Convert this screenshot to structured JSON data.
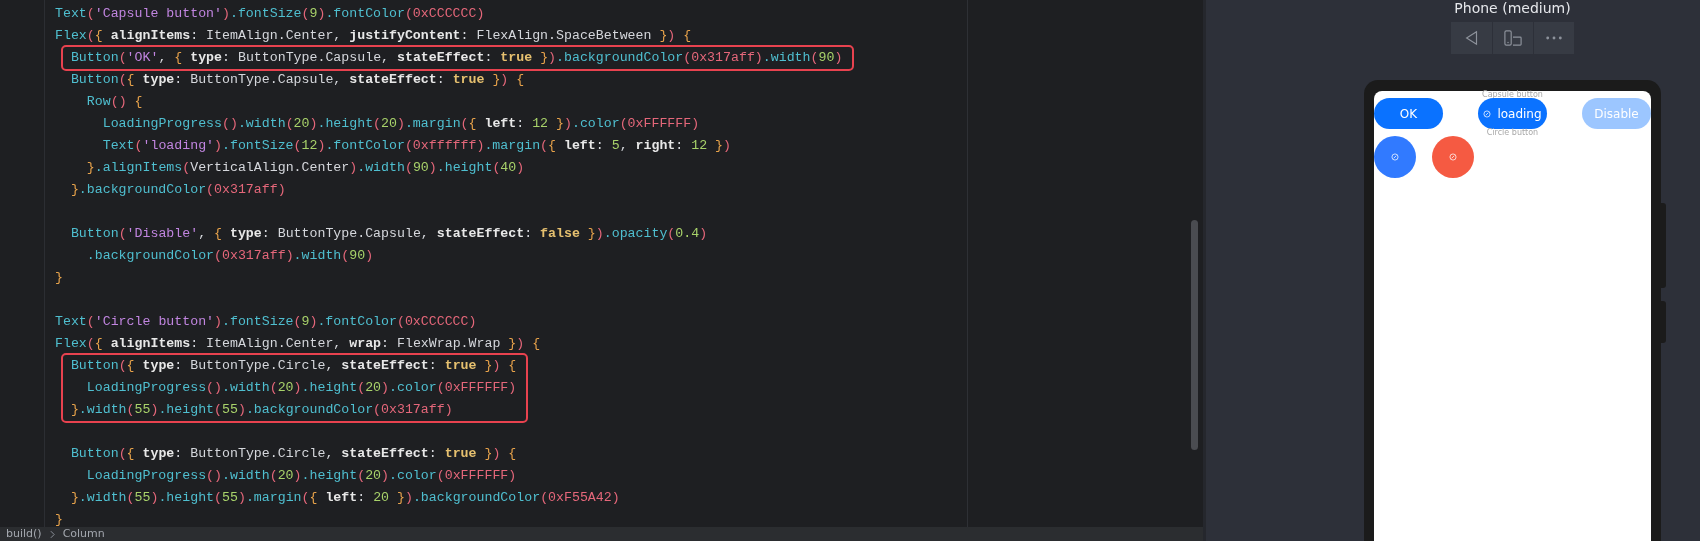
{
  "editor": {
    "code_blocks": [
      {
        "highlighted": false,
        "lines": [
          {
            "kind": "code",
            "text": "Text('Capsule button').fontSize(9).fontColor(0xCCCCCC)"
          },
          {
            "kind": "code",
            "text": "Flex({ alignItems: ItemAlign.Center, justifyContent: FlexAlign.SpaceBetween }) {"
          }
        ]
      },
      {
        "highlighted": true,
        "lines": [
          {
            "kind": "code",
            "text": "  Button('OK', { type: ButtonType.Capsule, stateEffect: true }).backgroundColor(0x317aff).width(90)"
          }
        ]
      },
      {
        "highlighted": false,
        "lines": [
          {
            "kind": "code",
            "text": "  Button({ type: ButtonType.Capsule, stateEffect: true }) {"
          },
          {
            "kind": "code",
            "text": "    Row() {"
          },
          {
            "kind": "code",
            "text": "      LoadingProgress().width(20).height(20).margin({ left: 12 }).color(0xFFFFFF)"
          },
          {
            "kind": "code",
            "text": "      Text('loading').fontSize(12).fontColor(0xffffff).margin({ left: 5, right: 12 })"
          },
          {
            "kind": "code",
            "text": "    }.alignItems(VerticalAlign.Center).width(90).height(40)"
          },
          {
            "kind": "code",
            "text": "  }.backgroundColor(0x317aff)"
          },
          {
            "kind": "blank"
          },
          {
            "kind": "code",
            "text": "  Button('Disable', { type: ButtonType.Capsule, stateEffect: false }).opacity(0.4)"
          },
          {
            "kind": "code",
            "text": "    .backgroundColor(0x317aff).width(90)"
          },
          {
            "kind": "code",
            "text": "}"
          },
          {
            "kind": "blank"
          },
          {
            "kind": "code",
            "text": "Text('Circle button').fontSize(9).fontColor(0xCCCCCC)"
          },
          {
            "kind": "code",
            "text": "Flex({ alignItems: ItemAlign.Center, wrap: FlexWrap.Wrap }) {"
          }
        ]
      },
      {
        "highlighted": true,
        "lines": [
          {
            "kind": "code",
            "text": "  Button({ type: ButtonType.Circle, stateEffect: true }) {"
          },
          {
            "kind": "code",
            "text": "    LoadingProgress().width(20).height(20).color(0xFFFFFF)"
          },
          {
            "kind": "code",
            "text": "  }.width(55).height(55).backgroundColor(0x317aff)"
          }
        ]
      },
      {
        "highlighted": false,
        "lines": [
          {
            "kind": "blank"
          },
          {
            "kind": "code",
            "text": "  Button({ type: ButtonType.Circle, stateEffect: true }) {"
          },
          {
            "kind": "code",
            "text": "    LoadingProgress().width(20).height(20).color(0xFFFFFF)"
          },
          {
            "kind": "code",
            "text": "  }.width(55).height(55).margin({ left: 20 }).backgroundColor(0xF55A42)"
          },
          {
            "kind": "code",
            "text": "}"
          }
        ]
      }
    ],
    "breadcrumbs": [
      "build()",
      "Column"
    ]
  },
  "preview": {
    "title": "Phone (medium)",
    "phone": {
      "capsule_label": "Capsule button",
      "capsule_buttons": [
        {
          "kind": "text",
          "label": "OK",
          "disabled": false
        },
        {
          "kind": "loading",
          "label": "loading",
          "disabled": false
        },
        {
          "kind": "text",
          "label": "Disable",
          "disabled": true
        }
      ],
      "circle_label": "Circle button",
      "circle_buttons": [
        {
          "color": "#317aff"
        },
        {
          "color": "#f55a42"
        }
      ]
    }
  }
}
